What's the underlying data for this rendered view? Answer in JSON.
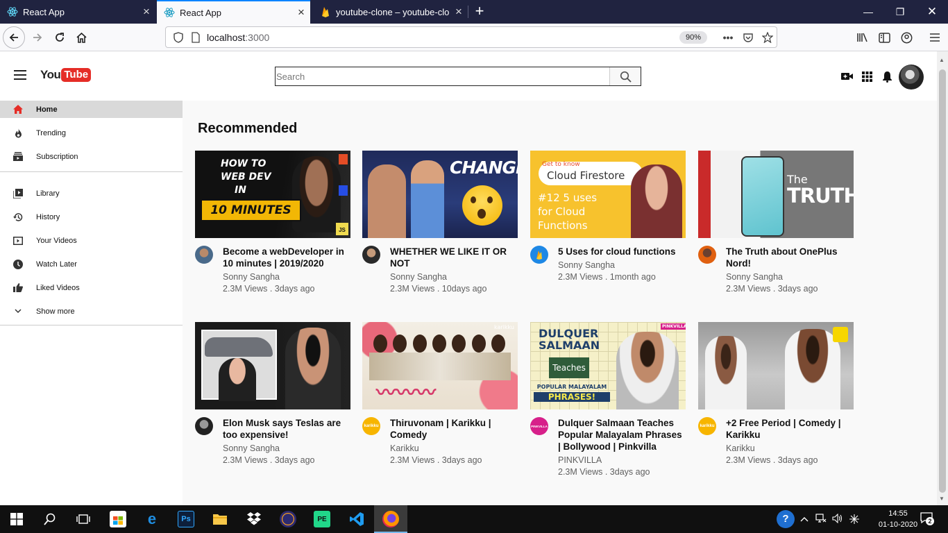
{
  "browser": {
    "tabs": [
      {
        "title": "React App",
        "icon": "react-icon"
      },
      {
        "title": "React App",
        "icon": "react-icon",
        "active": true
      },
      {
        "title": "youtube-clone – youtube-clone",
        "icon": "firebase-icon"
      }
    ],
    "url_host": "localhost",
    "url_port": ":3000",
    "zoom": "90%"
  },
  "header": {
    "logo_you": "You",
    "logo_tube": "Tube",
    "search_placeholder": "Search"
  },
  "sidebar": {
    "items": [
      {
        "label": "Home",
        "icon": "home-icon",
        "active": true
      },
      {
        "label": "Trending",
        "icon": "fire-icon"
      },
      {
        "label": "Subscription",
        "icon": "subscriptions-icon"
      },
      {
        "label": "Library",
        "icon": "library-icon"
      },
      {
        "label": "History",
        "icon": "history-icon"
      },
      {
        "label": "Your Videos",
        "icon": "your-videos-icon"
      },
      {
        "label": "Watch Later",
        "icon": "clock-icon"
      },
      {
        "label": "Liked Videos",
        "icon": "thumb-up-icon"
      },
      {
        "label": "Show more",
        "icon": "chevron-down-icon"
      }
    ]
  },
  "main": {
    "heading": "Recommended",
    "videos": [
      {
        "title": "Become a webDeveloper in 10 minutes | 2019/2020",
        "channel": "Sonny Sangha",
        "stats": "2.3M Views . 3days ago",
        "thumb_text": [
          "HOW TO",
          "WEB DEV",
          "IN",
          "10 MINUTES"
        ]
      },
      {
        "title": "WHETHER WE LIKE IT OR NOT",
        "channel": "Sonny Sangha",
        "stats": "2.3M Views . 10days ago",
        "thumb_text": [
          "CHANGE"
        ]
      },
      {
        "title": "5 Uses for cloud functions",
        "channel": "Sonny Sangha",
        "stats": "2.3M Views . 1month ago",
        "thumb_text": [
          "Get to know",
          "Cloud Firestore",
          "#12 5 uses",
          "for Cloud",
          "Functions"
        ]
      },
      {
        "title": "The Truth about OnePlus Nord!",
        "channel": "Sonny Sangha",
        "stats": "2.3M Views . 3days ago",
        "thumb_text": [
          "The",
          "TRUTH"
        ]
      },
      {
        "title": "Elon Musk says Teslas are too expensive!",
        "channel": "Sonny Sangha",
        "stats": "2.3M Views . 3days ago",
        "thumb_text": []
      },
      {
        "title": "Thiruvonam | Karikku | Comedy",
        "channel": "Karikku",
        "stats": "2.3M Views . 3days ago",
        "thumb_text": [
          "karikku"
        ]
      },
      {
        "title": "Dulquer Salmaan Teaches Popular Malayalam Phrases | Bollywood | Pinkvilla",
        "channel": "PINKVILLA",
        "stats": "2.3M Views . 3days ago",
        "thumb_text": [
          "DULQUER",
          "SALMAAN",
          "Teaches",
          "POPULAR MALAYALAM",
          "PHRASES!",
          "PINKVILLA"
        ]
      },
      {
        "title": "+2 Free Period | Comedy | Karikku",
        "channel": "Karikku",
        "stats": "2.3M Views . 3days ago",
        "thumb_text": []
      }
    ]
  },
  "taskbar": {
    "time": "14:55",
    "date": "01-10-2020",
    "notifications": "2"
  },
  "colors": {
    "brand_red": "#e52d27",
    "sidebar_active": "#d9d9d9",
    "tab_bar": "#202340",
    "accent_blue": "#0a84ff"
  }
}
